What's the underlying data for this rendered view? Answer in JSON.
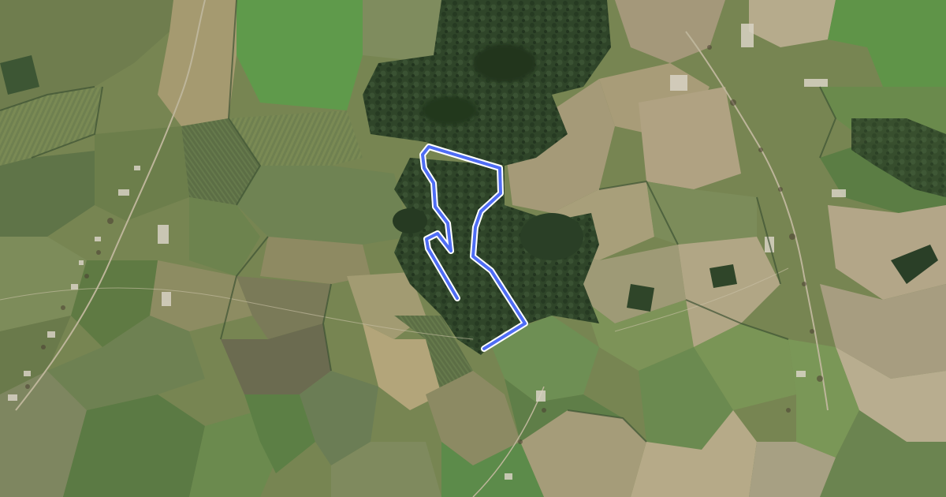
{
  "map": {
    "view": "satellite",
    "route": {
      "color": "#4f6df5",
      "outline_color": "#ffffff",
      "closed": false
    }
  }
}
